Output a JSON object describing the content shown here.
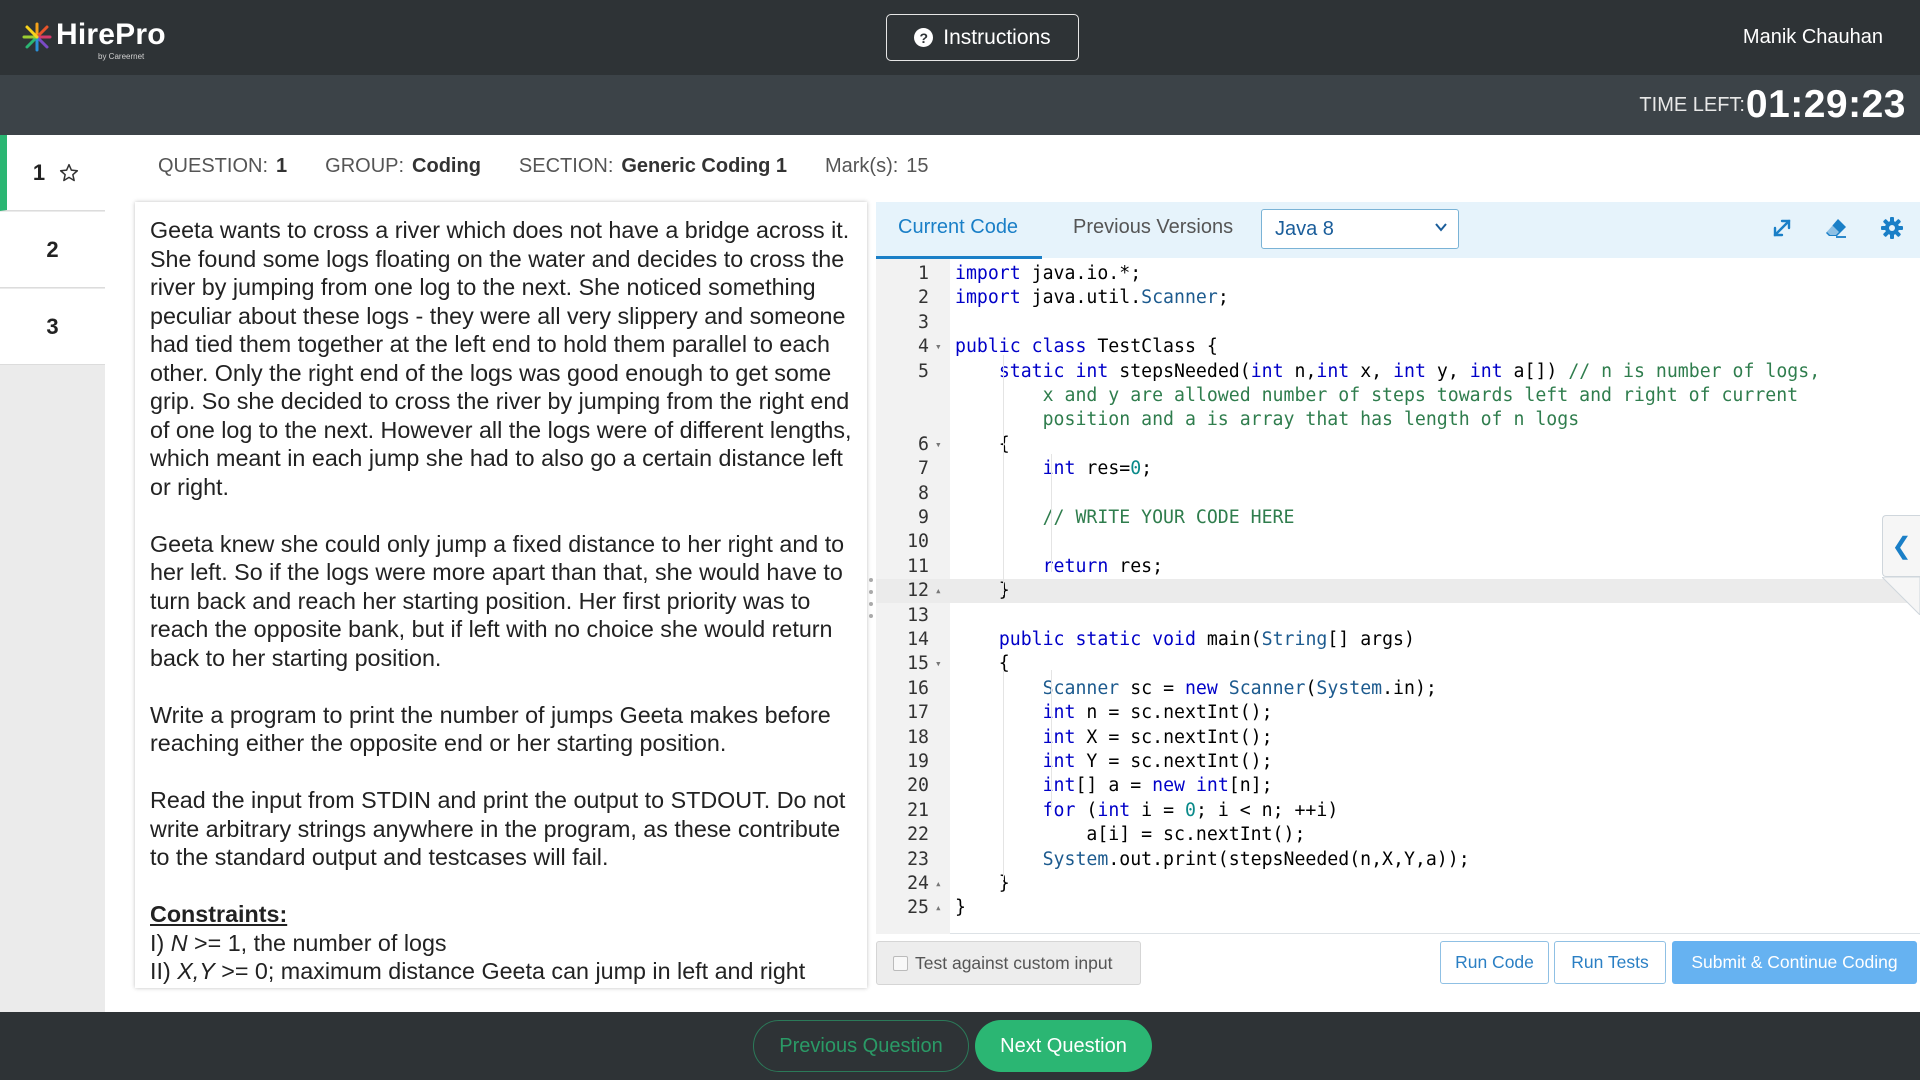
{
  "header": {
    "brand": "HirePro",
    "brand_sub": "by Careernet",
    "instructions_label": "Instructions",
    "user_name": "Manik Chauhan"
  },
  "timer": {
    "label": "TIME LEFT:",
    "value": "01:29:23"
  },
  "question_nav": {
    "items": [
      {
        "label": "1",
        "active": true,
        "starred_icon": "star-outline-icon"
      },
      {
        "label": "2",
        "active": false
      },
      {
        "label": "3",
        "active": false
      }
    ]
  },
  "meta": {
    "question_key": "QUESTION:",
    "question_val": "1",
    "group_key": "GROUP:",
    "group_val": "Coding",
    "section_key": "SECTION:",
    "section_val": "Generic Coding 1",
    "marks_key": "Mark(s):",
    "marks_val": "15"
  },
  "problem": {
    "para1": "Geeta wants to cross a river which does not have a bridge across it. She found some logs floating on the water and decides to cross the river by jumping from one log to the next. She noticed something peculiar about these logs - they were all very slippery and someone had tied them together at the left end to hold them parallel to each other. Only the right end of the logs was good enough to get some grip. So she decided to cross the river by jumping from the right end of one log to the next. However all the logs were of different lengths, which meant in each jump she had to also go a certain distance left or right.",
    "para2": "Geeta knew she could only jump a fixed distance to her right and to her left. So if the logs were more apart than that, she would have to turn back and reach her starting position. Her first priority was to reach the opposite bank, but if left with no choice she would return back to her starting position.",
    "para3": "Write a program to print the number of jumps Geeta makes before reaching either the opposite end or her starting position.",
    "para4": "Read the input from STDIN and print the output to STDOUT. Do not write arbitrary strings anywhere in the program, as these contribute to the standard output and testcases will fail.",
    "constraints_title": "Constraints:",
    "c1_prefix": "I) ",
    "c1_var": "N",
    "c1_rest": " >= 1, the number of logs",
    "c2_prefix": "II) ",
    "c2_var": "X,Y",
    "c2_rest": " >= 0; maximum distance Geeta can jump in left and right"
  },
  "editor": {
    "tab_current": "Current Code",
    "tab_previous": "Previous Versions",
    "language": "Java 8",
    "icons": [
      "expand-icon",
      "eraser-icon",
      "settings-gear-icon"
    ],
    "highlighted_line": 12,
    "lines": [
      {
        "n": "1",
        "fold": "",
        "code": "import java.io.*;"
      },
      {
        "n": "2",
        "fold": "",
        "code": "import java.util.Scanner;"
      },
      {
        "n": "3",
        "fold": "",
        "code": ""
      },
      {
        "n": "4",
        "fold": "▾",
        "code": "public class TestClass {"
      },
      {
        "n": "5",
        "fold": "",
        "code": "    static int stepsNeeded(int n,int x, int y, int a[]) // n is number of logs,"
      },
      {
        "n": "",
        "fold": "",
        "code": "        x and y are allowed number of steps towards left and right of current"
      },
      {
        "n": "",
        "fold": "",
        "code": "        position and a is array that has length of n logs"
      },
      {
        "n": "6",
        "fold": "▾",
        "code": "    {"
      },
      {
        "n": "7",
        "fold": "",
        "code": "        int res=0;"
      },
      {
        "n": "8",
        "fold": "",
        "code": ""
      },
      {
        "n": "9",
        "fold": "",
        "code": "        // WRITE YOUR CODE HERE"
      },
      {
        "n": "10",
        "fold": "",
        "code": ""
      },
      {
        "n": "11",
        "fold": "",
        "code": "        return res;"
      },
      {
        "n": "12",
        "fold": "▴",
        "code": "    }"
      },
      {
        "n": "13",
        "fold": "",
        "code": ""
      },
      {
        "n": "14",
        "fold": "",
        "code": "    public static void main(String[] args)"
      },
      {
        "n": "15",
        "fold": "▾",
        "code": "    {"
      },
      {
        "n": "16",
        "fold": "",
        "code": "        Scanner sc = new Scanner(System.in);"
      },
      {
        "n": "17",
        "fold": "",
        "code": "        int n = sc.nextInt();"
      },
      {
        "n": "18",
        "fold": "",
        "code": "        int X = sc.nextInt();"
      },
      {
        "n": "19",
        "fold": "",
        "code": "        int Y = sc.nextInt();"
      },
      {
        "n": "20",
        "fold": "",
        "code": "        int[] a = new int[n];"
      },
      {
        "n": "21",
        "fold": "",
        "code": "        for (int i = 0; i < n; ++i)"
      },
      {
        "n": "22",
        "fold": "",
        "code": "            a[i] = sc.nextInt();"
      },
      {
        "n": "23",
        "fold": "",
        "code": "        System.out.print(stepsNeeded(n,X,Y,a));"
      },
      {
        "n": "24",
        "fold": "▴",
        "code": "    }"
      },
      {
        "n": "25",
        "fold": "▴",
        "code": "}"
      }
    ]
  },
  "footer": {
    "custom_input_label": "Test against custom input",
    "run_code": "Run Code",
    "run_tests": "Run Tests",
    "submit": "Submit & Continue Coding"
  },
  "bottom": {
    "prev": "Previous Question",
    "next": "Next Question"
  },
  "colors": {
    "topbar": "#2e3336",
    "accent_green": "#2bb673",
    "accent_blue": "#1a7fc7",
    "submit_blue": "#66b2f1"
  }
}
